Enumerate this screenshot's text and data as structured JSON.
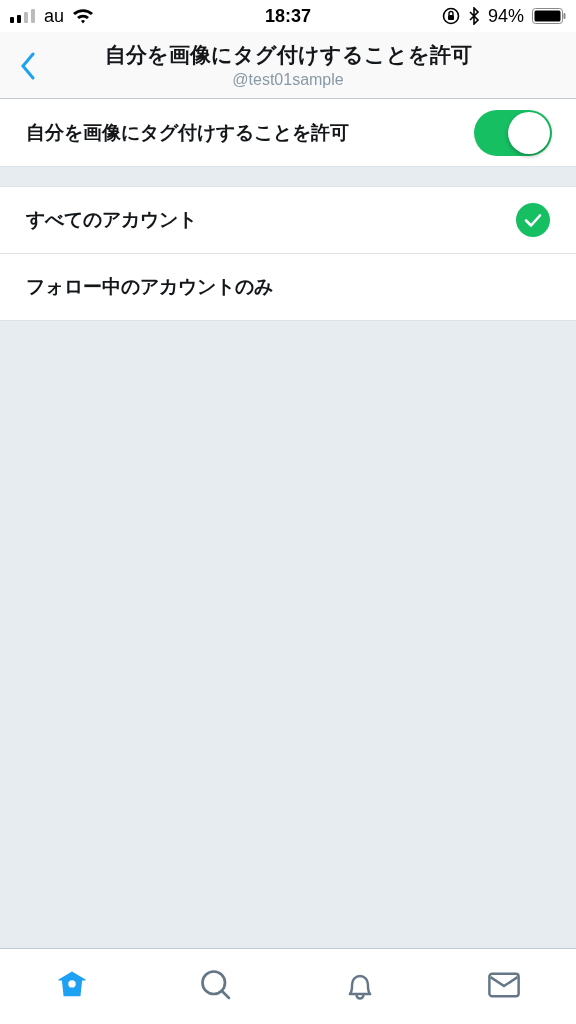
{
  "status_bar": {
    "carrier": "au",
    "time": "18:37",
    "battery": "94%"
  },
  "header": {
    "title": "自分を画像にタグ付けすることを許可",
    "subtitle": "@test01sample"
  },
  "setting": {
    "label": "自分を画像にタグ付けすることを許可",
    "on": true
  },
  "options": [
    {
      "label": "すべてのアカウント",
      "selected": true
    },
    {
      "label": "フォロー中のアカウントのみ",
      "selected": false
    }
  ],
  "tab_bar": [
    {
      "kind": "home",
      "selected": true
    },
    {
      "kind": "search",
      "selected": false
    },
    {
      "kind": "notifications",
      "selected": false
    },
    {
      "kind": "messages",
      "selected": false
    }
  ]
}
